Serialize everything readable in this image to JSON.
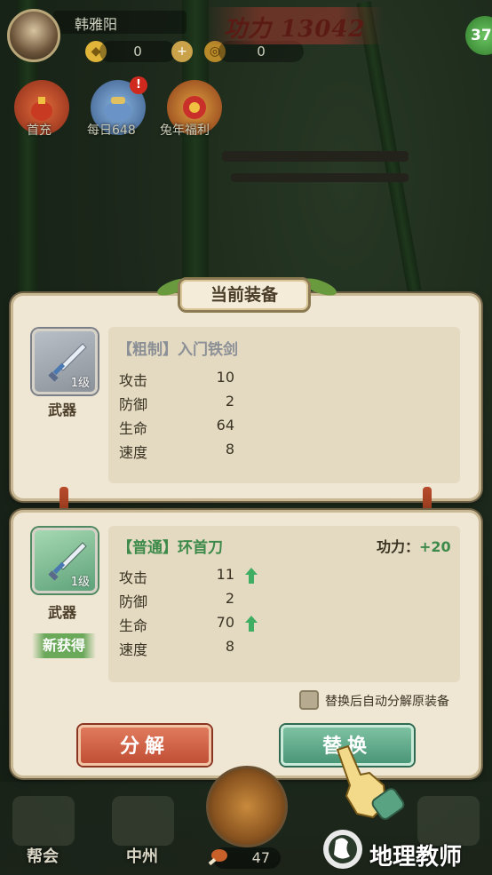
{
  "player": {
    "name": "韩雅阳",
    "level_badge": "37"
  },
  "resources": {
    "ingot": "0",
    "coin": "0"
  },
  "power_banner": {
    "text": "功力 13042"
  },
  "events": [
    {
      "label": "首充",
      "icon": "gift-bag-icon"
    },
    {
      "label": "每日648",
      "icon": "treasure-pouch-icon",
      "badge": "!"
    },
    {
      "label": "兔年福利",
      "icon": "lantern-icon"
    }
  ],
  "current_equipment": {
    "title": "当前装备",
    "slot_level": "1级",
    "slot_type": "武器",
    "item_name": "【粗制】入门铁剑",
    "stats": [
      {
        "label": "攻击",
        "value": "10"
      },
      {
        "label": "防御",
        "value": "2"
      },
      {
        "label": "生命",
        "value": "64"
      },
      {
        "label": "速度",
        "value": "8"
      }
    ]
  },
  "new_equipment": {
    "slot_level": "1级",
    "slot_type": "武器",
    "new_tag": "新获得",
    "item_name": "【普通】环首刀",
    "power_label": "功力：",
    "power_value": "+20",
    "stats": [
      {
        "label": "攻击",
        "value": "11",
        "up": true
      },
      {
        "label": "防御",
        "value": "2",
        "up": false
      },
      {
        "label": "生命",
        "value": "70",
        "up": true
      },
      {
        "label": "速度",
        "value": "8",
        "up": false
      }
    ],
    "auto_decompose_label": "替换后自动分解原装备",
    "auto_decompose_checked": false
  },
  "buttons": {
    "decompose": "分解",
    "replace": "替换"
  },
  "bottom_nav": {
    "guild": "帮会",
    "zhongzhou": "中州",
    "food_count": "47"
  },
  "watermark": {
    "text": "地理教师"
  },
  "colors": {
    "panel_bg": "#efe7d4",
    "rarity_grey": "#8b929a",
    "rarity_green": "#3d8a4a",
    "decompose_btn": "#c14f35",
    "replace_btn": "#4a9677"
  }
}
